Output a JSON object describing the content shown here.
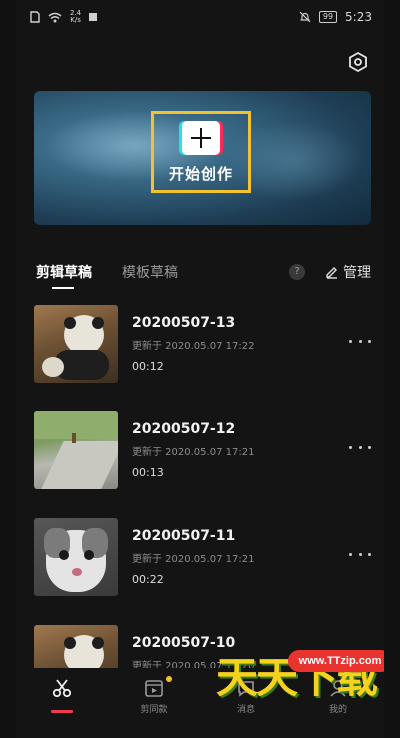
{
  "status_bar": {
    "network_speed_value": "2.4",
    "network_speed_unit": "K/s",
    "battery": "99",
    "time": "5:23"
  },
  "header": {
    "settings_icon": "hexagon-gear-icon"
  },
  "banner": {
    "create_label": "开始创作",
    "highlight_color": "#f2c230"
  },
  "tabs": {
    "items": [
      {
        "label": "剪辑草稿",
        "active": true
      },
      {
        "label": "模板草稿",
        "active": false
      }
    ],
    "help_label": "?",
    "manage_label": "管理"
  },
  "drafts": [
    {
      "title": "20200507-13",
      "updated": "更新于 2020.05.07 17:22",
      "duration": "00:12",
      "thumb": "panda"
    },
    {
      "title": "20200507-12",
      "updated": "更新于 2020.05.07 17:21",
      "duration": "00:13",
      "thumb": "road"
    },
    {
      "title": "20200507-11",
      "updated": "更新于 2020.05.07 17:21",
      "duration": "00:22",
      "thumb": "cat"
    },
    {
      "title": "20200507-10",
      "updated": "更新于 2020.05.07 17:20",
      "duration": "",
      "thumb": "panda"
    }
  ],
  "bottom_nav": {
    "items": [
      {
        "label": "",
        "icon": "scissors-icon",
        "active": true
      },
      {
        "label": "剪同款",
        "icon": "template-clip-icon",
        "active": false,
        "badge": true
      },
      {
        "label": "消息",
        "icon": "message-icon",
        "active": false
      },
      {
        "label": "我的",
        "icon": "profile-icon",
        "active": false
      }
    ],
    "active_color": "#ef3b4f",
    "badge_color": "#f5c028"
  },
  "watermark": {
    "url": "www.TTzip.com",
    "text": "天天下载"
  }
}
